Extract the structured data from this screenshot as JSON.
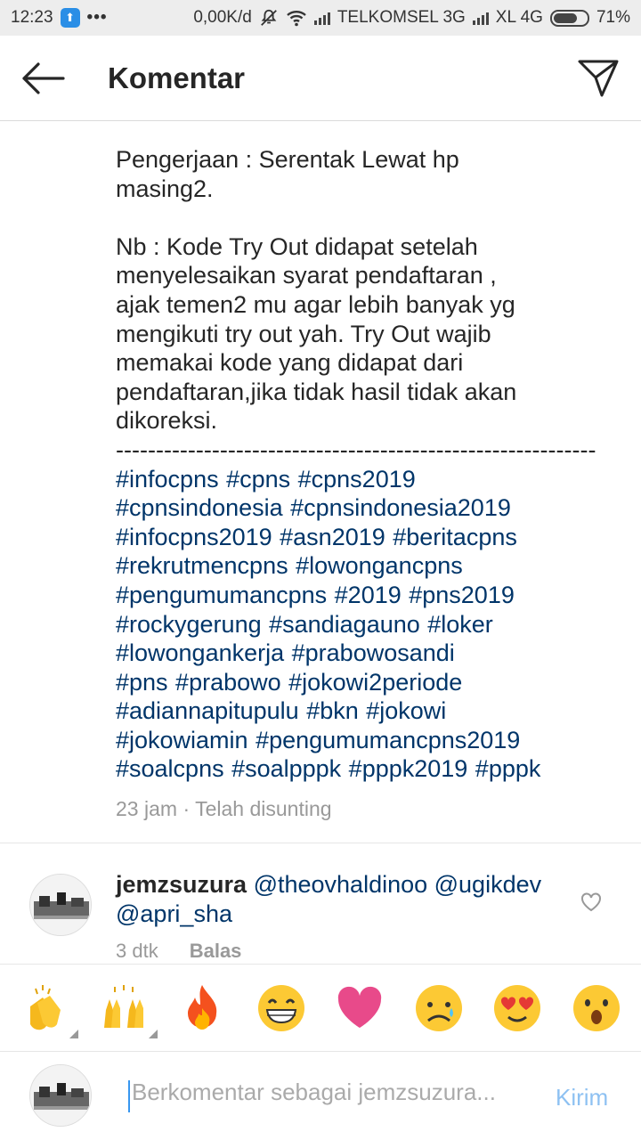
{
  "status_bar": {
    "time": "12:23",
    "dots": "•••",
    "net_speed": "0,00K/d",
    "carrier1": "TELKOMSEL 3G",
    "carrier2": "XL 4G",
    "battery_level": 0.71,
    "battery_text": "71%"
  },
  "header": {
    "title": "Komentar"
  },
  "caption": {
    "para1": "Pengerjaan : Serentak Lewat hp\nmasing2.",
    "para2": "Nb : Kode Try Out didapat setelah\nmenyelesaikan syarat pendaftaran ,\najak temen2 mu agar lebih banyak yg\nmengikuti try out yah. Try Out wajib\nmemakai kode yang didapat dari\npendaftaran,jika tidak hasil tidak akan\ndikoreksi.",
    "divider": "------------------------------------------------------------",
    "hashtags": [
      "#infocpns #cpns #cpns2019",
      "#cpnsindonesia #cpnsindonesia2019",
      "#infocpns2019 #asn2019 #beritacpns",
      "#rekrutmencpns #lowongancpns",
      "#pengumumancpns #2019 #pns2019",
      "#rockygerung #sandiagauno #loker",
      "#lowongankerja #prabowosandi",
      "#pns #prabowo #jokowi2periode",
      "#adiannapitupulu #bkn #jokowi",
      "#jokowiamin #pengumumancpns2019",
      "#soalcpns #soalpppk #pppk2019 #pppk"
    ],
    "time": "23 jam",
    "separator": "·",
    "edited": "Telah disunting"
  },
  "comment": {
    "username": "jemzsuzura",
    "text_line1": "@theovhaldinoo @ugikdev",
    "text_line2": "@apri_sha",
    "time": "3 dtk",
    "reply": "Balas"
  },
  "emojis": [
    "👏",
    "🙌",
    "🔥",
    "😁",
    "❤️",
    "😢",
    "😍",
    "😮"
  ],
  "composer": {
    "placeholder": "Berkomentar sebagai jemzsuzura...",
    "post": "Kirim"
  }
}
